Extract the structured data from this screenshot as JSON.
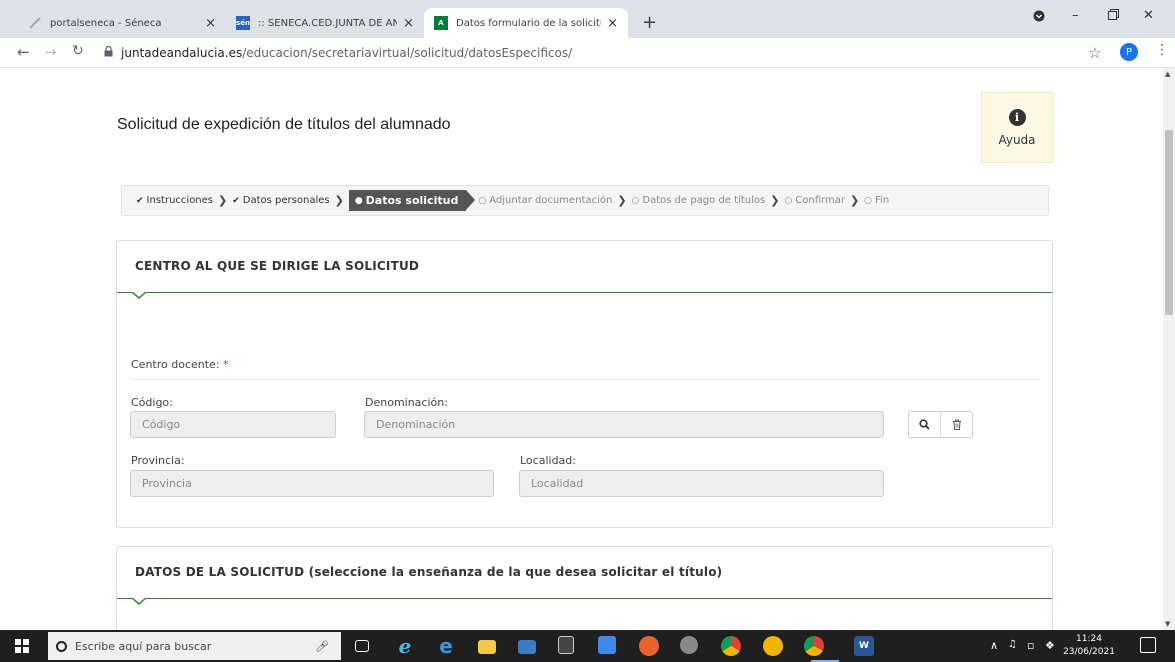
{
  "browser": {
    "tabs": [
      {
        "title": "portalseneca - Séneca",
        "favicon": "seneca-leaf-icon"
      },
      {
        "title": ":: SENECA.CED.JUNTA DE ANDALU",
        "favicon_text": "sén"
      },
      {
        "title": "Datos formulario de la solicitud",
        "favicon_text": "A"
      }
    ],
    "new_tab": "+",
    "close_glyph": "×",
    "url_host": "juntadeandalucia.es",
    "url_path": "/educacion/secretariavirtual/solicitud/datosEspecificos/",
    "profile_initial": "P"
  },
  "page": {
    "title": "Solicitud de expedición de títulos del alumnado",
    "help_label": "Ayuda",
    "help_icon_text": "i",
    "steps": [
      {
        "label": "Instrucciones",
        "state": "done"
      },
      {
        "label": "Datos personales",
        "state": "done"
      },
      {
        "label": "Datos solicitud",
        "state": "current"
      },
      {
        "label": "Adjuntar documentación",
        "state": "pending"
      },
      {
        "label": "Datos de pago de títulos",
        "state": "pending"
      },
      {
        "label": "Confirmar",
        "state": "pending"
      },
      {
        "label": "Fin",
        "state": "pending"
      }
    ],
    "section1": {
      "heading": "CENTRO AL QUE SE DIRIGE LA SOLICITUD",
      "centro_label": "Centro docente:",
      "required_mark": "*",
      "codigo_label": "Código:",
      "codigo_placeholder": "Código",
      "denominacion_label": "Denominación:",
      "denominacion_placeholder": "Denominación",
      "provincia_label": "Provincia:",
      "provincia_placeholder": "Provincia",
      "localidad_label": "Localidad:",
      "localidad_placeholder": "Localidad"
    },
    "section2": {
      "heading": "DATOS DE LA SOLICITUD (seleccione la enseñanza de la que desea solicitar el título)"
    }
  },
  "taskbar": {
    "search_placeholder": "Escribe aquí para buscar",
    "time": "11:24",
    "date": "23/06/2021"
  },
  "colors": {
    "accent_green": "#3c7d3e",
    "step_current_bg": "#555555",
    "required_red": "#c9302c",
    "help_bg": "#fcf8e3"
  }
}
